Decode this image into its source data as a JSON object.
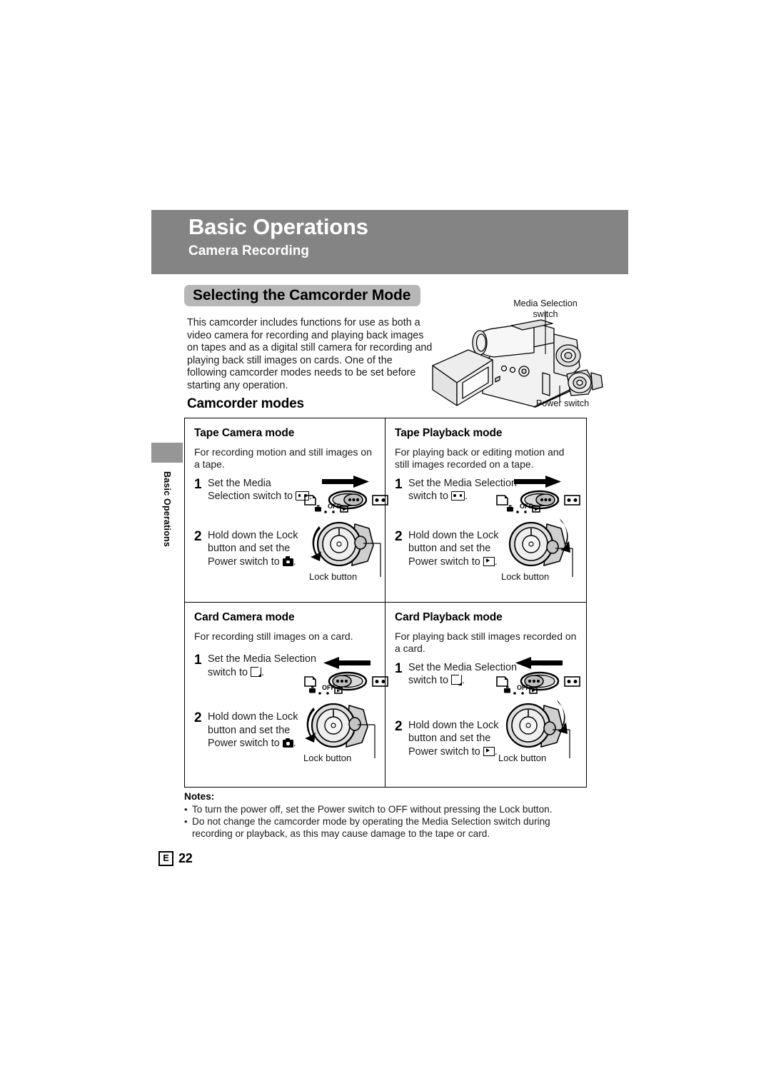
{
  "chapter": {
    "title": "Basic Operations",
    "subtitle": "Camera Recording",
    "band_color": "#848484"
  },
  "section": {
    "pill_label": "Selecting the Camcorder Mode",
    "pill_color": "#b7b7b7",
    "intro": "This camcorder includes functions for use as both a video camera for recording and playing back images on tapes and as a digital still camera for recording and playing back still images on cards. One of the following camcorder modes needs to be set before starting any operation.",
    "modes_heading": "Camcorder modes"
  },
  "illustration": {
    "media_selection_label": "Media Selection\nswitch",
    "power_switch_label": "Power switch"
  },
  "sidetab": {
    "label": "Basic Operations",
    "block_color": "#969696"
  },
  "modes": [
    {
      "title": "Tape Camera mode",
      "description": "For recording motion and still images on a tape.",
      "step1_num": "1",
      "step1_text_a": "Set the Media",
      "step1_text_b": "Selection switch to",
      "step1_target_icon": "tape-icon",
      "step1_period": ".",
      "switch_position": "right",
      "switch_arrow": "right",
      "step2_num": "2",
      "step2_text_a": "Hold down the Lock",
      "step2_text_b": "button and set the",
      "step2_text_c": "Power switch to",
      "step2_target_icon": "camera-icon",
      "step2_period": ".",
      "dial_target": "camera",
      "lock_caption": "Lock button"
    },
    {
      "title": "Tape Playback mode",
      "description": "For playing back or editing motion and still images recorded on a tape.",
      "step1_num": "1",
      "step1_text_a": "Set the Media Selection",
      "step1_text_b": "switch to",
      "step1_target_icon": "tape-icon",
      "step1_period": ".",
      "switch_position": "right",
      "switch_arrow": "right",
      "step2_num": "2",
      "step2_text_a": "Hold down the Lock",
      "step2_text_b": "button and set the",
      "step2_text_c": "Power switch to",
      "step2_target_icon": "play-icon",
      "step2_period": ".",
      "dial_target": "play",
      "lock_caption": "Lock button"
    },
    {
      "title": "Card Camera mode",
      "description": "For recording still images on a card.",
      "step1_num": "1",
      "step1_text_a": "Set the Media Selection",
      "step1_text_b": "switch to",
      "step1_target_icon": "card-icon",
      "step1_period": ".",
      "switch_position": "left",
      "switch_arrow": "left",
      "step2_num": "2",
      "step2_text_a": "Hold down the Lock",
      "step2_text_b": "button and set the",
      "step2_text_c": "Power switch to",
      "step2_target_icon": "camera-icon",
      "step2_period": ".",
      "dial_target": "camera",
      "lock_caption": "Lock button"
    },
    {
      "title": "Card Playback mode",
      "description": "For playing back still images recorded on a card.",
      "step1_num": "1",
      "step1_text_a": "Set the Media Selection",
      "step1_text_b": "switch to",
      "step1_target_icon": "card-icon",
      "step1_period": ".",
      "switch_position": "left",
      "switch_arrow": "left",
      "step2_num": "2",
      "step2_text_a": "Hold down the Lock",
      "step2_text_b": "button and set the",
      "step2_text_c": "Power switch to",
      "step2_target_icon": "play-icon",
      "step2_period": ".",
      "dial_target": "play",
      "lock_caption": "Lock button"
    }
  ],
  "dial_marks": {
    "off": "OFF"
  },
  "notes": {
    "title": "Notes:",
    "bullet": "•",
    "items": [
      "To turn the power off, set the Power switch to OFF without pressing the Lock button.",
      "Do not change the camcorder mode by operating the Media Selection switch during recording or playback, as this may cause damage to the tape or card."
    ]
  },
  "footer": {
    "region_code": "E",
    "page_number": "22"
  }
}
